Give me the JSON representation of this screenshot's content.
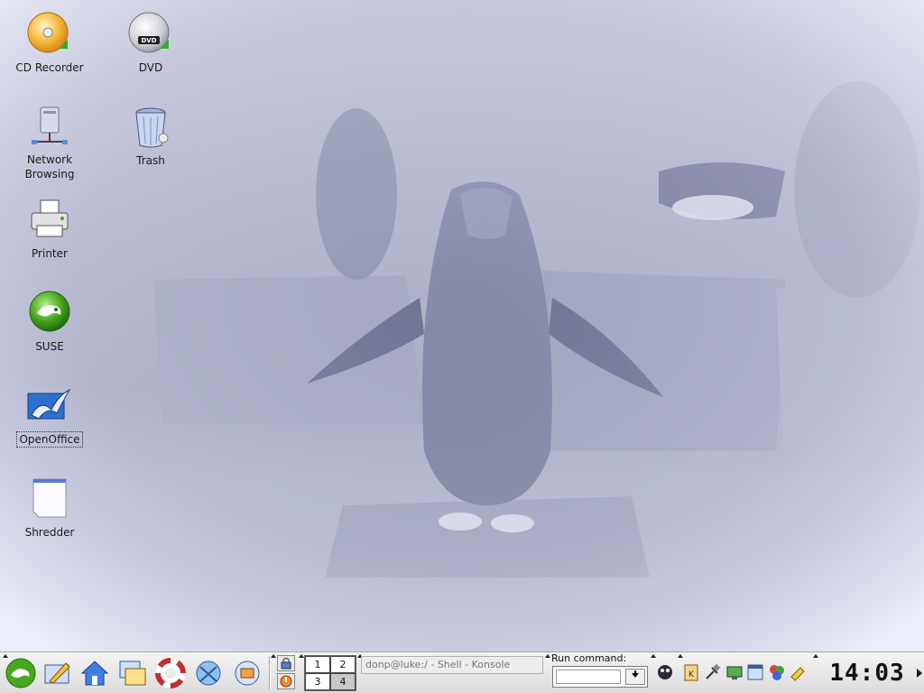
{
  "desktop_icons": [
    {
      "name": "cd-recorder",
      "label": "CD Recorder",
      "icon": "cd-recorder-icon"
    },
    {
      "name": "dvd",
      "label": "DVD",
      "icon": "dvd-icon"
    },
    {
      "name": "network-browsing",
      "label": "Network Browsing",
      "icon": "network-icon"
    },
    {
      "name": "trash",
      "label": "Trash",
      "icon": "trash-icon"
    },
    {
      "name": "printer",
      "label": "Printer",
      "icon": "printer-icon"
    },
    {
      "name": "suse",
      "label": "SUSE",
      "icon": "suse-icon"
    },
    {
      "name": "openoffice",
      "label": "OpenOffice",
      "icon": "openoffice-icon",
      "selected": true
    },
    {
      "name": "shredder",
      "label": "Shredder",
      "icon": "shredder-icon"
    }
  ],
  "taskbar": {
    "launchers": [
      {
        "name": "kmenu",
        "icon": "suse-chameleon-icon"
      },
      {
        "name": "desktop-access",
        "icon": "desktop-icon"
      },
      {
        "name": "home",
        "icon": "home-icon"
      },
      {
        "name": "window-list",
        "icon": "windows-icon"
      },
      {
        "name": "help",
        "icon": "lifebuoy-icon"
      },
      {
        "name": "browser",
        "icon": "konqueror-icon"
      },
      {
        "name": "system",
        "icon": "kcontrol-icon"
      }
    ],
    "pager": [
      "1",
      "2",
      "3",
      "4"
    ],
    "active_desktop": "4",
    "task_label": "donp@luke:/ - Shell - Konsole",
    "run_command": {
      "label": "Run command:",
      "value": ""
    },
    "clock": "14:03",
    "colors": {
      "panel": "#e6e6e6",
      "suse_green": "#46a81e",
      "accent_blue": "#2e6fd0"
    }
  }
}
